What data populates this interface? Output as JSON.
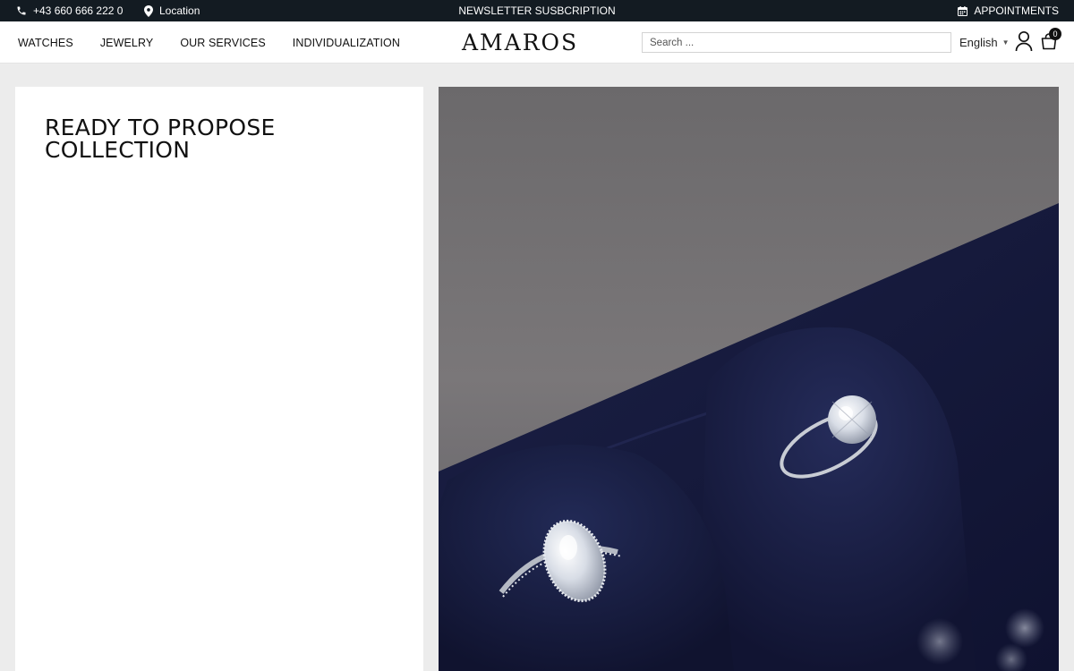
{
  "topbar": {
    "phone": "+43 660 666 222 0",
    "location": "Location",
    "newsletter": "NEWSLETTER SUSBCRIPTION",
    "appointments": "APPOINTMENTS",
    "icons": [
      "phone-icon",
      "location-pin-icon",
      "calendar-icon"
    ]
  },
  "nav": {
    "items": [
      "WATCHES",
      "JEWELRY",
      "OUR SERVICES",
      "INDIVIDUALIZATION"
    ]
  },
  "brand": {
    "logo": "AMAROS"
  },
  "search": {
    "placeholder": "Search ...",
    "value": ""
  },
  "language": {
    "selected": "English"
  },
  "cart": {
    "count": "0"
  },
  "hero": {
    "heading": "READY TO PROPOSE COLLECTION"
  },
  "colors": {
    "topbar_bg": "#131b22",
    "page_bg": "#ececec",
    "velvet_blue": "#15193a"
  }
}
